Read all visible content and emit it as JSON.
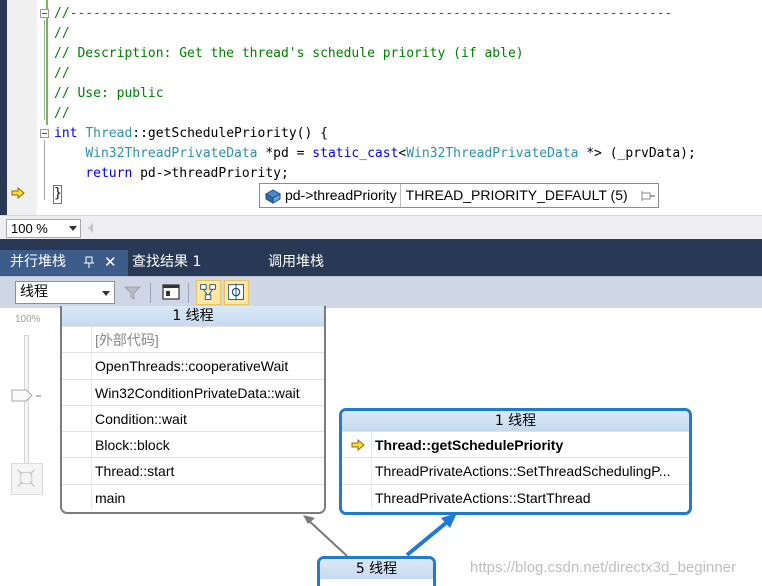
{
  "editor": {
    "lines": [
      {
        "id": "l1",
        "parts": [
          {
            "c": "cmt",
            "t": "//-----------------------------------------------------------------------------"
          }
        ]
      },
      {
        "id": "l2",
        "parts": [
          {
            "c": "cmt",
            "t": "//"
          }
        ]
      },
      {
        "id": "l3",
        "parts": [
          {
            "c": "cmt",
            "t": "// Description: Get the thread's schedule priority (if able)"
          }
        ]
      },
      {
        "id": "l4",
        "parts": [
          {
            "c": "cmt",
            "t": "//"
          }
        ]
      },
      {
        "id": "l5",
        "parts": [
          {
            "c": "cmt",
            "t": "// Use: public"
          }
        ]
      },
      {
        "id": "l6",
        "parts": [
          {
            "c": "cmt",
            "t": "//"
          }
        ]
      },
      {
        "id": "l7",
        "parts": [
          {
            "c": "kw",
            "t": "int"
          },
          {
            "c": "tx",
            "t": " "
          },
          {
            "c": "ty",
            "t": "Thread"
          },
          {
            "c": "tx",
            "t": "::getSchedulePriority() {"
          }
        ]
      },
      {
        "id": "l8",
        "parts": [
          {
            "c": "tx",
            "t": "    "
          },
          {
            "c": "ty",
            "t": "Win32ThreadPrivateData"
          },
          {
            "c": "tx",
            "t": " *pd = "
          },
          {
            "c": "kw",
            "t": "static_cast"
          },
          {
            "c": "tx",
            "t": "<"
          },
          {
            "c": "ty",
            "t": "Win32ThreadPrivateData"
          },
          {
            "c": "tx",
            "t": " *> (_prvData);"
          }
        ]
      },
      {
        "id": "l9",
        "parts": [
          {
            "c": "tx",
            "t": "    "
          },
          {
            "c": "kw",
            "t": "return"
          },
          {
            "c": "tx",
            "t": " pd->threadPriority;"
          }
        ]
      },
      {
        "id": "l10",
        "parts": [
          {
            "c": "tx",
            "t": "}"
          }
        ]
      }
    ],
    "datatip": {
      "name": "pd->threadPriority",
      "value": "THREAD_PRIORITY_DEFAULT (5)"
    },
    "zoom": "100 %"
  },
  "toolwindow": {
    "tabs": [
      {
        "label": "并行堆栈",
        "active": true
      },
      {
        "label": "查找结果 1",
        "active": false
      },
      {
        "label": "调用堆栈",
        "active": false
      }
    ],
    "view_select": "线程"
  },
  "slider": {
    "label": "100%"
  },
  "boxes": {
    "left": {
      "header": "1 线程",
      "rows": [
        "[外部代码]",
        "OpenThreads::cooperativeWait",
        "Win32ConditionPrivateData::wait",
        "Condition::wait",
        "Block::block",
        "Thread::start",
        "main"
      ]
    },
    "right": {
      "header": "1 线程",
      "rows": [
        "Thread::getSchedulePriority",
        "ThreadPrivateActions::SetThreadSchedulingP...",
        "ThreadPrivateActions::StartThread"
      ]
    },
    "bottom": {
      "header": "5 线程"
    }
  },
  "watermark": "https://blog.csdn.net/directx3d_beginner",
  "colors": {
    "frame": "#293955",
    "active_tab": "#3e5c8a",
    "active_path": "#1e7ad3",
    "comment": "#008000",
    "keyword": "#0000ff",
    "type": "#2b91af"
  }
}
